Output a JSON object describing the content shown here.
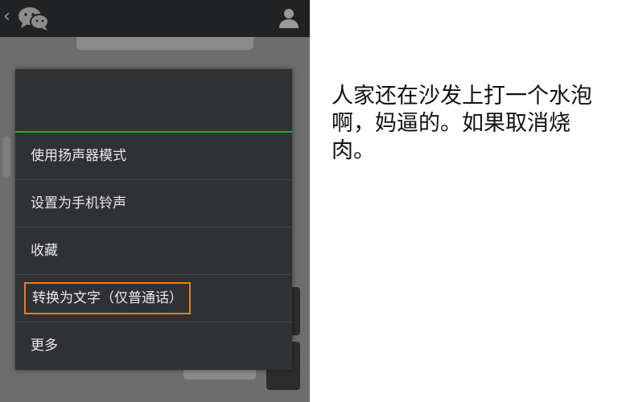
{
  "menu": {
    "items": [
      {
        "label": "使用扬声器模式"
      },
      {
        "label": "设置为手机铃声"
      },
      {
        "label": "收藏"
      },
      {
        "label": "转换为文字（仅普通话）"
      },
      {
        "label": "更多"
      }
    ]
  },
  "caption": {
    "text": "人家还在沙发上打一个水泡啊，妈逼的。如果取消烧肉。"
  },
  "colors": {
    "menu_background": "#2f3134",
    "accent_divider": "#2aa538",
    "highlight_border": "#f07c1c",
    "title_bar": "#202224"
  },
  "icons": {
    "back": "chevron-left-icon",
    "app": "chat-bubbles-icon",
    "profile": "person-icon"
  }
}
